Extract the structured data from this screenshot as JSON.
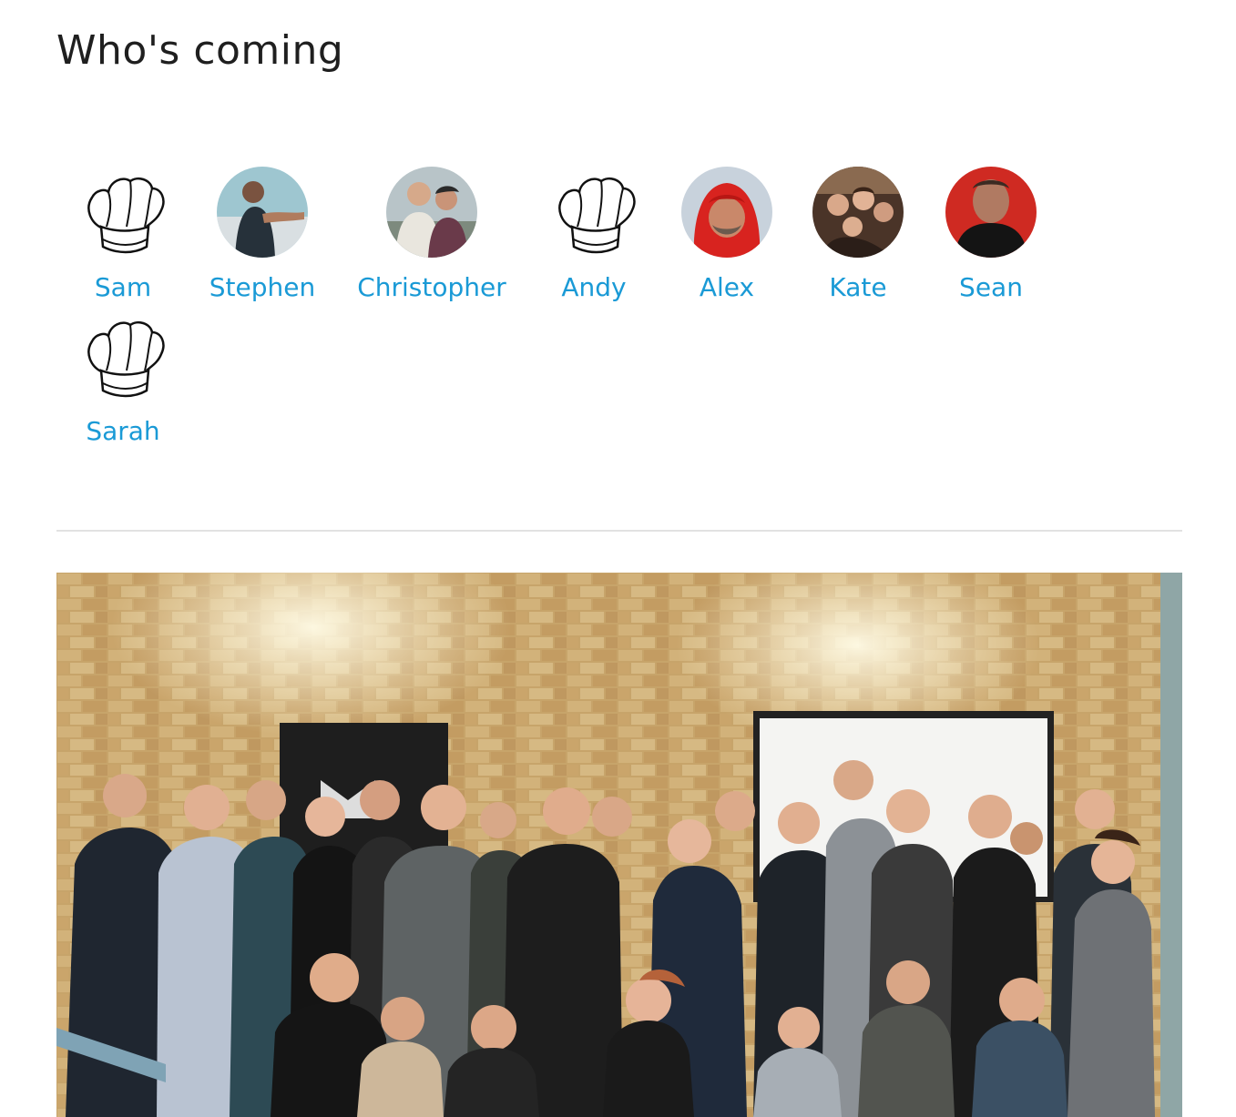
{
  "section": {
    "title": "Who's coming"
  },
  "attendees": [
    {
      "name": "Sam",
      "avatar": "chef-hat-icon"
    },
    {
      "name": "Stephen",
      "avatar": "photo"
    },
    {
      "name": "Christopher",
      "avatar": "photo"
    },
    {
      "name": "Andy",
      "avatar": "chef-hat-icon"
    },
    {
      "name": "Alex",
      "avatar": "photo"
    },
    {
      "name": "Kate",
      "avatar": "photo"
    },
    {
      "name": "Sean",
      "avatar": "photo"
    },
    {
      "name": "Sarah",
      "avatar": "chef-hat-icon"
    }
  ],
  "colors": {
    "link": "#1a9ad6",
    "title": "#1f1f1f",
    "divider": "#e2e2e2",
    "brick": "#c9a86a"
  }
}
